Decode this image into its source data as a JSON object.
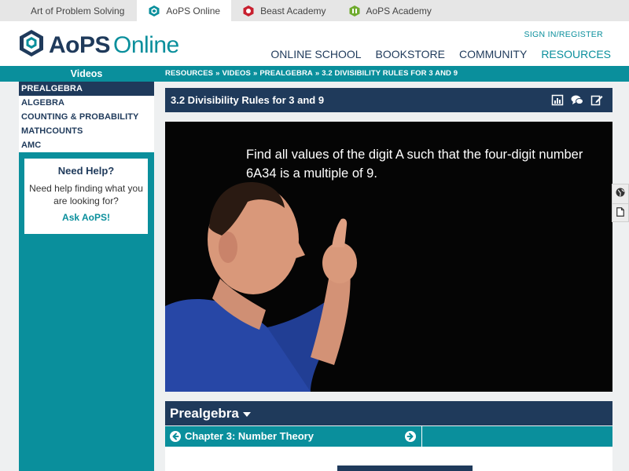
{
  "sitebar": {
    "tabs": [
      {
        "label": "Art of Problem Solving"
      },
      {
        "label": "AoPS Online"
      },
      {
        "label": "Beast Academy"
      },
      {
        "label": "AoPS Academy"
      }
    ]
  },
  "header": {
    "logo_main": "AoPS",
    "logo_sub": "Online",
    "signin": "SIGN IN/REGISTER",
    "nav": [
      {
        "label": "ONLINE SCHOOL"
      },
      {
        "label": "BOOKSTORE"
      },
      {
        "label": "COMMUNITY"
      },
      {
        "label": "RESOURCES"
      }
    ]
  },
  "strip": {
    "title": "Videos",
    "breadcrumb": [
      "RESOURCES",
      "VIDEOS",
      "PREALGEBRA",
      "3.2 DIVISIBILITY RULES FOR 3 AND 9"
    ],
    "separator": "»"
  },
  "sidebar": {
    "items": [
      {
        "label": "PREALGEBRA"
      },
      {
        "label": "ALGEBRA"
      },
      {
        "label": "COUNTING & PROBABILITY"
      },
      {
        "label": "MATHCOUNTS"
      },
      {
        "label": "AMC"
      }
    ],
    "help": {
      "title": "Need Help?",
      "text": "Need help finding what you are looking for?",
      "link": "Ask AoPS!"
    }
  },
  "video": {
    "title": "3.2 Divisibility Rules for 3 and 9",
    "caption_line1": "Find all values of the digit A such that the four-digit number",
    "caption_line2": "6A34 is a multiple of 9."
  },
  "course": {
    "title": "Prealgebra",
    "chapter": "Chapter 3: Number Theory"
  },
  "colors": {
    "navy": "#1f3a5b",
    "teal": "#0a8f9c"
  }
}
